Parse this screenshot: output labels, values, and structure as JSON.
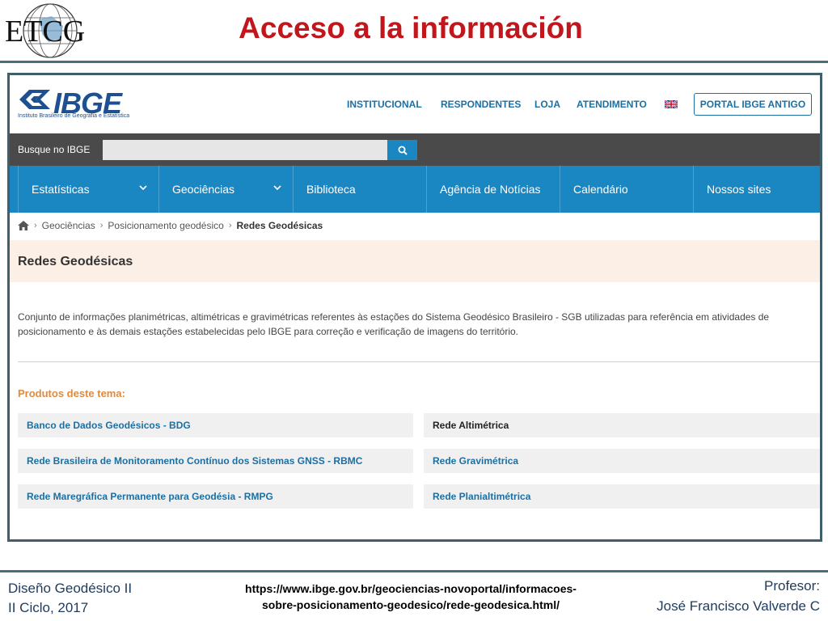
{
  "slide": {
    "logo_text": "ETCG",
    "title": "Acceso a la información"
  },
  "ibge": {
    "logo": "IBGE",
    "logo_subtitle": "Instituto Brasileiro de Geografia e Estatística",
    "top_nav": [
      "INSTITUCIONAL",
      "RESPONDENTES",
      "LOJA",
      "ATENDIMENTO"
    ],
    "portal_button": "PORTAL IBGE ANTIGO",
    "search": {
      "label": "Busque no IBGE",
      "placeholder": ""
    },
    "main_nav": [
      {
        "label": "Estatísticas",
        "dropdown": true
      },
      {
        "label": "Geociências",
        "dropdown": true
      },
      {
        "label": "Biblioteca",
        "dropdown": false
      },
      {
        "label": "Agência de Notícias",
        "dropdown": false
      },
      {
        "label": "Calendário",
        "dropdown": false
      },
      {
        "label": "Nossos sites",
        "dropdown": false
      }
    ],
    "breadcrumb": [
      "Geociências",
      "Posicionamento geodésico",
      "Redes Geodésicas"
    ],
    "page_title": "Redes Geodésicas",
    "description": "Conjunto de informações planimétricas, altimétricas e gravimétricas referentes às estações do Sistema Geodésico Brasileiro - SGB utilizadas para referência em atividades de posicionamento e às demais estações estabelecidas pelo IBGE para correção e verificação de imagens do território.",
    "products_heading": "Produtos deste tema:",
    "products_left": [
      "Banco de Dados Geodésicos - BDG",
      "Rede Brasileira de Monitoramento Contínuo dos Sistemas GNSS - RBMC",
      "Rede Maregráfica Permanente para Geodésia - RMPG"
    ],
    "products_right": [
      "Rede Altimétrica",
      "Rede Gravimétrica",
      "Rede Planialtimétrica"
    ],
    "colors": {
      "brand_blue": "#1a87c3",
      "link_blue": "#1c6fa3",
      "accent_orange": "#e08a3c"
    }
  },
  "footer": {
    "course": "Diseño Geodésico II",
    "term": "II Ciclo, 2017",
    "url_line1": "https://www.ibge.gov.br/geociencias-novoportal/informacoes-",
    "url_line2": "sobre-posicionamento-geodesico/rede-geodesica.html/",
    "professor_label": "Profesor:",
    "professor_name": "José Francisco Valverde C"
  }
}
